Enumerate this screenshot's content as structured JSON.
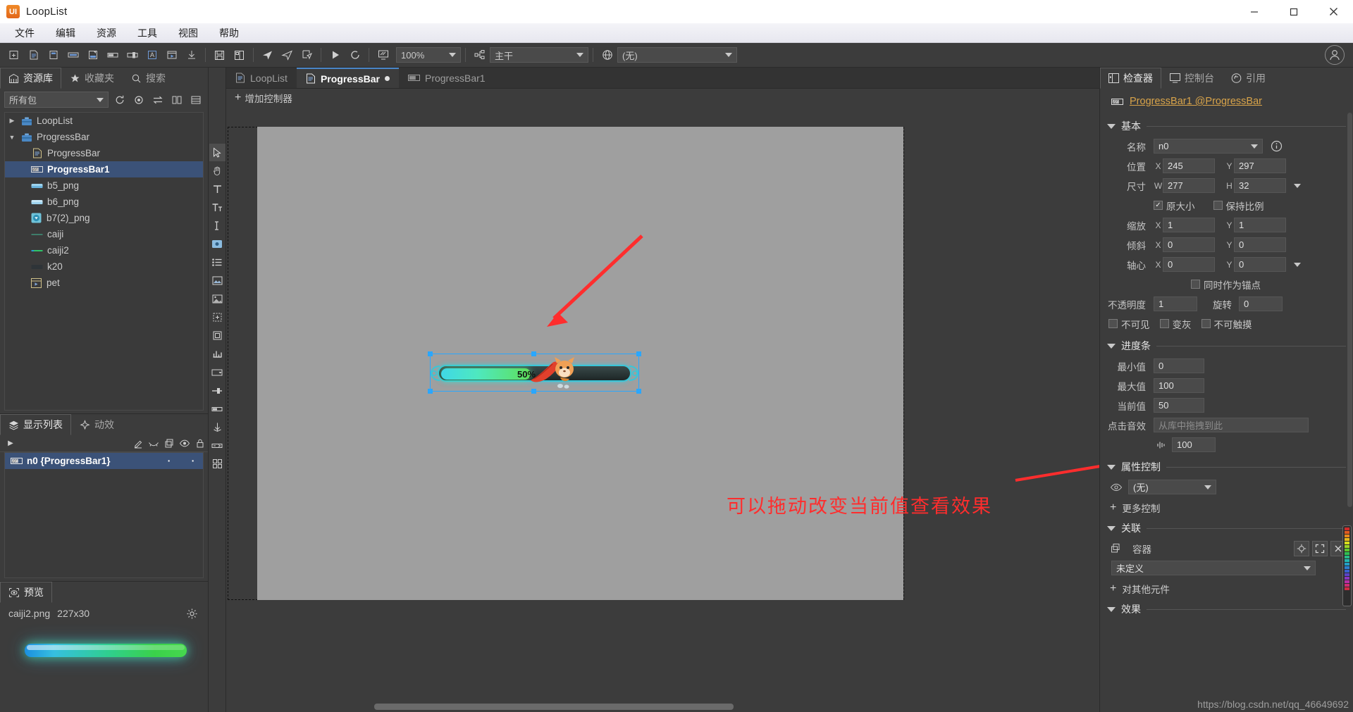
{
  "window": {
    "app_name": "LoopList",
    "logo_text": "UI",
    "minimize": "minimize-icon",
    "maximize": "maximize-icon",
    "close": "close-icon"
  },
  "menubar": {
    "items": [
      "文件",
      "编辑",
      "资源",
      "工具",
      "视图",
      "帮助"
    ]
  },
  "toolbar": {
    "zoom": "100%",
    "branch": "主干",
    "locale": "(无)",
    "buttons": [
      "new-package-icon",
      "new-document-icon",
      "new-component-icon",
      "new-button-icon",
      "new-label-icon",
      "new-progressbar-icon",
      "new-slider-icon",
      "new-textinput-icon",
      "new-movieclip-icon",
      "import-icon",
      "save-icon",
      "save-all-icon",
      "publish-icon",
      "publish-all-icon",
      "publish-settings-icon",
      "run-icon",
      "refresh-icon",
      "preview-icon"
    ]
  },
  "library": {
    "tabs": [
      {
        "label": "资源库",
        "icon": "library-icon",
        "active": true
      },
      {
        "label": "收藏夹",
        "icon": "star-icon",
        "active": false
      },
      {
        "label": "搜索",
        "icon": "search-icon",
        "active": false
      }
    ],
    "package_filter": "所有包",
    "tool_icons": [
      "refresh-icon",
      "locate-icon",
      "sync-icon",
      "columns-icon",
      "list-icon"
    ],
    "tree": [
      {
        "label": "LoopList",
        "icon": "package-icon",
        "depth": 0,
        "twist": "collapsed",
        "selected": false
      },
      {
        "label": "ProgressBar",
        "icon": "package-icon",
        "depth": 0,
        "twist": "expanded",
        "selected": false
      },
      {
        "label": "ProgressBar",
        "icon": "component-icon",
        "depth": 1,
        "twist": "",
        "selected": false
      },
      {
        "label": "ProgressBar1",
        "icon": "progressbar-icon",
        "depth": 1,
        "twist": "",
        "selected": true
      },
      {
        "label": "b5_png",
        "icon": "image-blue-icon",
        "depth": 1,
        "twist": "",
        "selected": false
      },
      {
        "label": "b6_png",
        "icon": "image-blue-icon",
        "depth": 1,
        "twist": "",
        "selected": false
      },
      {
        "label": "b7(2)_png",
        "icon": "image-arrow-icon",
        "depth": 1,
        "twist": "",
        "selected": false
      },
      {
        "label": "caiji",
        "icon": "image-line-icon",
        "depth": 1,
        "twist": "",
        "selected": false
      },
      {
        "label": "caiji2",
        "icon": "image-line2-icon",
        "depth": 1,
        "twist": "",
        "selected": false
      },
      {
        "label": "k20",
        "icon": "image-dark-icon",
        "depth": 1,
        "twist": "",
        "selected": false
      },
      {
        "label": "pet",
        "icon": "movieclip-icon",
        "depth": 1,
        "twist": "",
        "selected": false
      }
    ]
  },
  "display_list": {
    "tabs": [
      {
        "label": "显示列表",
        "icon": "layers-icon",
        "active": true
      },
      {
        "label": "动效",
        "icon": "sparkle-icon",
        "active": false
      }
    ],
    "column_icons": [
      "expand-icon",
      "edit-icon",
      "gizmo-icon",
      "duplicate-icon",
      "visible-icon",
      "lock-icon"
    ],
    "rows": [
      {
        "label": "n0 {ProgressBar1}",
        "icon": "progressbar-icon",
        "selected": true,
        "dot1": "·",
        "dot2": "·"
      }
    ]
  },
  "preview": {
    "tabs": [
      {
        "label": "预览",
        "icon": "preview-eye-icon",
        "active": true
      }
    ],
    "file_name": "caiji2.png",
    "dimensions": "227x30",
    "settings_icon": "gear-icon"
  },
  "tools": {
    "items": [
      "pointer-tool",
      "hand-tool",
      "text-tool",
      "richtext-tool",
      "input-tool",
      "button-tool",
      "list-tool",
      "image-tool",
      "loader-tool",
      "group-tool",
      "container-tool",
      "graph-tool",
      "combobox-tool",
      "slider-tool",
      "scrollbar-tool",
      "progress-tool",
      "tree-tool",
      "align-tool",
      "grid-tool"
    ],
    "selected_index": 0
  },
  "document_tabs": [
    {
      "label": "LoopList",
      "icon": "component-icon",
      "active": false,
      "modified": false
    },
    {
      "label": "ProgressBar",
      "icon": "component-icon",
      "active": true,
      "modified": true
    },
    {
      "label": "ProgressBar1",
      "icon": "progressbar-icon",
      "active": false,
      "modified": false
    }
  ],
  "stage": {
    "add_controller_label": "增加控制器",
    "add_controller_icon": "plus-icon",
    "progress_label": "50%",
    "annotation_text": "可以拖动改变当前值查看效果",
    "annotation_color": "#ff2d2d",
    "fill_percent": 47
  },
  "inspector": {
    "tabs": [
      {
        "label": "检查器",
        "icon": "inspector-icon",
        "active": true
      },
      {
        "label": "控制台",
        "icon": "console-icon",
        "active": false
      },
      {
        "label": "引用",
        "icon": "reference-icon",
        "active": false
      }
    ],
    "object_icon": "progressbar-icon",
    "object_title": "ProgressBar1 @ProgressBar",
    "object_title_color": "#d9a44a",
    "sections": {
      "basic": {
        "title": "基本",
        "name_label": "名称",
        "name_value": "n0",
        "info_icon": "info-icon",
        "position_label": "位置",
        "position_x": "245",
        "position_y": "297",
        "size_label": "尺寸",
        "size_w": "277",
        "size_h": "32",
        "original_size_label": "原大小",
        "original_size_checked": true,
        "keep_ratio_label": "保持比例",
        "keep_ratio_checked": false,
        "scale_label": "缩放",
        "scale_x": "1",
        "scale_y": "1",
        "skew_label": "倾斜",
        "skew_x": "0",
        "skew_y": "0",
        "pivot_label": "轴心",
        "pivot_x": "0",
        "pivot_y": "0",
        "anchor_label": "同时作为锚点",
        "anchor_checked": false,
        "opacity_label": "不透明度",
        "opacity_value": "1",
        "rotation_label": "旋转",
        "rotation_value": "0",
        "invisible_label": "不可见",
        "invisible_checked": false,
        "grayed_label": "变灰",
        "grayed_checked": false,
        "untouchable_label": "不可触摸",
        "untouchable_checked": false
      },
      "progressbar": {
        "title": "进度条",
        "min_label": "最小值",
        "min_value": "0",
        "max_label": "最大值",
        "max_value": "100",
        "current_label": "当前值",
        "current_value": "50",
        "sound_label": "点击音效",
        "sound_placeholder": "从库中拖拽到此",
        "volume_icon": "volume-icon",
        "volume_value": "100"
      },
      "attribute_control": {
        "title": "属性控制",
        "eye_icon": "eye-icon",
        "controller_value": "(无)",
        "more_label": "更多控制",
        "more_icon": "plus-icon"
      },
      "relation": {
        "title": "关联",
        "container_icon": "container-icon",
        "container_label": "容器",
        "container_value": "未定义",
        "target_icon": "target-icon",
        "fullscreen_icon": "fullscreen-icon",
        "clear_icon": "close-icon",
        "other_label": "对其他元件",
        "other_icon": "plus-icon"
      },
      "effect": {
        "title": "效果"
      }
    }
  },
  "watermark": "https://blog.csdn.net/qq_46649692",
  "colors": {
    "accent_blue": "#4a86c8",
    "selection": "#3b5278",
    "panel_bg": "#3c3c3c",
    "stage_bg": "#9f9f9f",
    "annotation_red": "#ff2d2d",
    "object_title": "#d9a44a"
  }
}
